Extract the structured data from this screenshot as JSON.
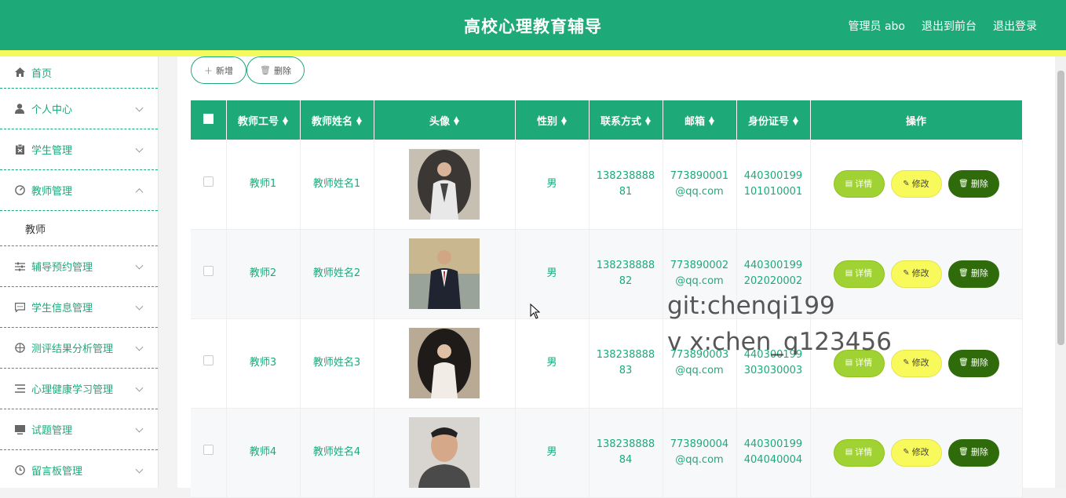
{
  "header": {
    "title": "高校心理教育辅导",
    "admin": "管理员 abo",
    "to_front": "退出到前台",
    "logout": "退出登录"
  },
  "sidebar": {
    "items": [
      {
        "label": "首页",
        "icon": "home-icon"
      },
      {
        "label": "个人中心",
        "icon": "user-icon"
      },
      {
        "label": "学生管理",
        "icon": "clipboard-icon"
      },
      {
        "label": "教师管理",
        "icon": "dashboard-icon",
        "expanded": true,
        "sub": [
          "教师"
        ]
      },
      {
        "label": "辅导预约管理",
        "icon": "sliders-icon"
      },
      {
        "label": "学生信息管理",
        "icon": "message-icon"
      },
      {
        "label": "测评结果分析管理",
        "icon": "compass-icon"
      },
      {
        "label": "心理健康学习管理",
        "icon": "list-icon"
      },
      {
        "label": "试题管理",
        "icon": "monitor-icon"
      },
      {
        "label": "留言板管理",
        "icon": "clock-icon"
      }
    ]
  },
  "toolbar": {
    "add_label": "新增",
    "delete_label": "删除"
  },
  "table": {
    "headers": [
      "教师工号",
      "教师姓名",
      "头像",
      "性别",
      "联系方式",
      "邮箱",
      "身份证号",
      "操作"
    ],
    "rows": [
      {
        "id": "教师1",
        "name": "教师姓名1",
        "gender": "男",
        "phone": "13823888881",
        "email": "773890001@qq.com",
        "idcard": "440300199101010001"
      },
      {
        "id": "教师2",
        "name": "教师姓名2",
        "gender": "男",
        "phone": "13823888882",
        "email": "773890002@qq.com",
        "idcard": "440300199202020002"
      },
      {
        "id": "教师3",
        "name": "教师姓名3",
        "gender": "男",
        "phone": "13823888883",
        "email": "773890003@qq.com",
        "idcard": "440300199303030003"
      },
      {
        "id": "教师4",
        "name": "教师姓名4",
        "gender": "男",
        "phone": "13823888884",
        "email": "773890004@qq.com",
        "idcard": "440300199404040004"
      }
    ],
    "actions": {
      "detail": "详情",
      "edit": "修改",
      "delete": "删除"
    }
  },
  "watermark": {
    "line1": "git:chenqi199",
    "line2": "v x:chen_q123456"
  },
  "colors": {
    "primary": "#1eaa78",
    "accent_yellow": "#f2fa5c",
    "detail_btn": "#a0d233",
    "edit_btn": "#f8fa5c",
    "delete_btn": "#2f6b0a"
  }
}
